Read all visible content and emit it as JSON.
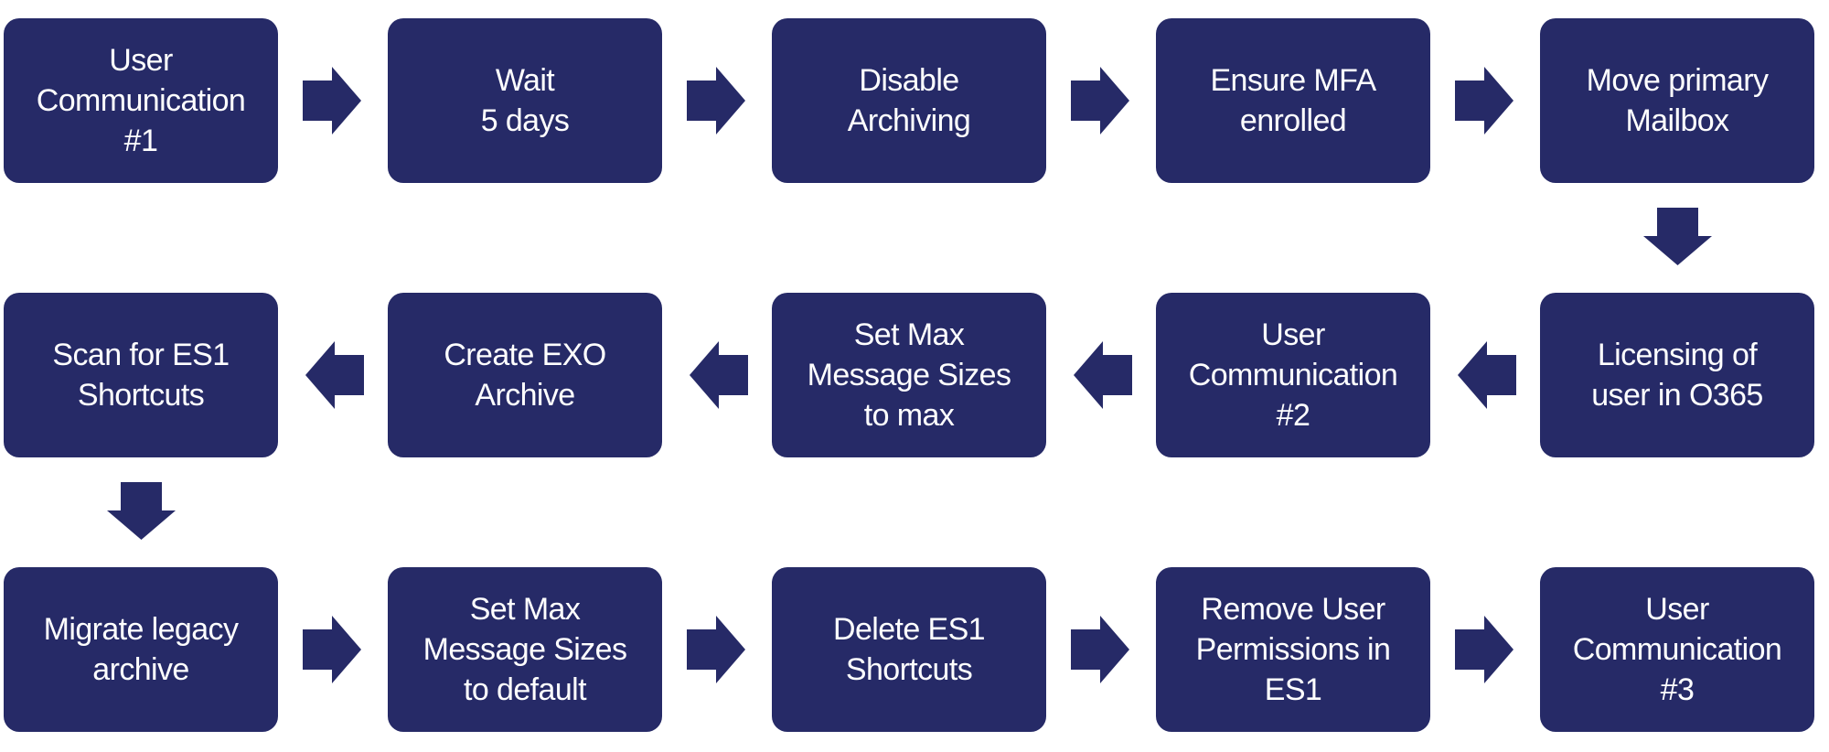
{
  "diagram": {
    "title": "",
    "colors": {
      "box_fill": "#262A67",
      "arrow_fill": "#262A67",
      "text": "#FFFFFF",
      "background": "#FFFFFF"
    },
    "layout": {
      "rows": 3,
      "columns": 5,
      "flow": "serpentine"
    },
    "steps": [
      {
        "id": 1,
        "row": 1,
        "col": 1,
        "label": "User\nCommunication\n#1"
      },
      {
        "id": 2,
        "row": 1,
        "col": 2,
        "label": "Wait\n5 days"
      },
      {
        "id": 3,
        "row": 1,
        "col": 3,
        "label": "Disable\nArchiving"
      },
      {
        "id": 4,
        "row": 1,
        "col": 4,
        "label": "Ensure MFA\nenrolled"
      },
      {
        "id": 5,
        "row": 1,
        "col": 5,
        "label": "Move primary\nMailbox"
      },
      {
        "id": 6,
        "row": 2,
        "col": 5,
        "label": "Licensing of\nuser in O365"
      },
      {
        "id": 7,
        "row": 2,
        "col": 4,
        "label": "User\nCommunication\n#2"
      },
      {
        "id": 8,
        "row": 2,
        "col": 3,
        "label": "Set Max\nMessage Sizes\nto max"
      },
      {
        "id": 9,
        "row": 2,
        "col": 2,
        "label": "Create EXO\nArchive"
      },
      {
        "id": 10,
        "row": 2,
        "col": 1,
        "label": "Scan for ES1\nShortcuts"
      },
      {
        "id": 11,
        "row": 3,
        "col": 1,
        "label": "Migrate legacy\narchive"
      },
      {
        "id": 12,
        "row": 3,
        "col": 2,
        "label": "Set Max\nMessage Sizes\nto default"
      },
      {
        "id": 13,
        "row": 3,
        "col": 3,
        "label": "Delete ES1\nShortcuts"
      },
      {
        "id": 14,
        "row": 3,
        "col": 4,
        "label": "Remove User\nPermissions in\nES1"
      },
      {
        "id": 15,
        "row": 3,
        "col": 5,
        "label": "User\nCommunication\n#3"
      }
    ],
    "connectors": [
      {
        "from": 1,
        "to": 2,
        "direction": "right"
      },
      {
        "from": 2,
        "to": 3,
        "direction": "right"
      },
      {
        "from": 3,
        "to": 4,
        "direction": "right"
      },
      {
        "from": 4,
        "to": 5,
        "direction": "right"
      },
      {
        "from": 5,
        "to": 6,
        "direction": "down"
      },
      {
        "from": 6,
        "to": 7,
        "direction": "left"
      },
      {
        "from": 7,
        "to": 8,
        "direction": "left"
      },
      {
        "from": 8,
        "to": 9,
        "direction": "left"
      },
      {
        "from": 9,
        "to": 10,
        "direction": "left"
      },
      {
        "from": 10,
        "to": 11,
        "direction": "down"
      },
      {
        "from": 11,
        "to": 12,
        "direction": "right"
      },
      {
        "from": 12,
        "to": 13,
        "direction": "right"
      },
      {
        "from": 13,
        "to": 14,
        "direction": "right"
      },
      {
        "from": 14,
        "to": 15,
        "direction": "right"
      }
    ]
  }
}
